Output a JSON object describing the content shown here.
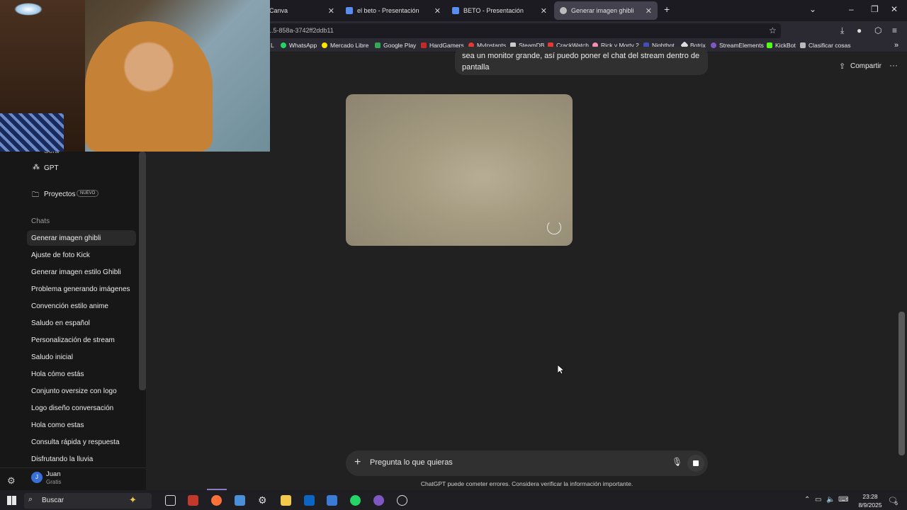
{
  "browser": {
    "tabs": [
      {
        "title": "Canva"
      },
      {
        "title": "el beto - Presentación"
      },
      {
        "title": "BETO - Presentación"
      },
      {
        "title": "Generar imagen ghibli"
      }
    ],
    "url": "...5-858a-3742ff2ddb11",
    "bookmarks": [
      "L",
      "WhatsApp",
      "Mercado Libre",
      "Google Play",
      "HardGamers",
      "MyInstants",
      "SteamDB",
      "CrackWatch",
      "Rick y Morty 2",
      "Nightbot",
      "Botrix",
      "StreamElements",
      "KickBot",
      "Clasificar cosas"
    ]
  },
  "sidebar": {
    "partial_top": "Sora",
    "gpt_label": "GPT",
    "projects_label": "Proyectos",
    "projects_badge": "NUEVO",
    "chats_header": "Chats",
    "chats": [
      "Generar imagen ghibli",
      "Ajuste de foto Kick",
      "Generar imagen estilo Ghibli",
      "Problema generando imágenes",
      "Convención estilo anime",
      "Saludo en español",
      "Personalización de stream",
      "Saludo inicial",
      "Hola cómo estás",
      "Conjunto oversize con logo",
      "Logo diseño conversación",
      "Hola como estas",
      "Consulta rápida y respuesta",
      "Disfrutando la lluvia"
    ],
    "user": {
      "initial": "J",
      "name": "Juan",
      "plan": "Gratis"
    }
  },
  "main": {
    "share_label": "Compartir",
    "user_message_line1": "sea un monitor grande, así puedo poner el chat del stream dentro de la",
    "user_message_line2": "pantalla",
    "composer_placeholder": "Pregunta lo que quieras",
    "disclaimer": "ChatGPT puede cometer errores. Considera verificar la información importante."
  },
  "taskbar": {
    "search_label": "Buscar",
    "time": "23:28",
    "date": "8/9/2025",
    "notification_count": "5"
  },
  "colors": {
    "accent": "#8e7cc3",
    "background": "#212121",
    "sidebar": "#171717"
  }
}
